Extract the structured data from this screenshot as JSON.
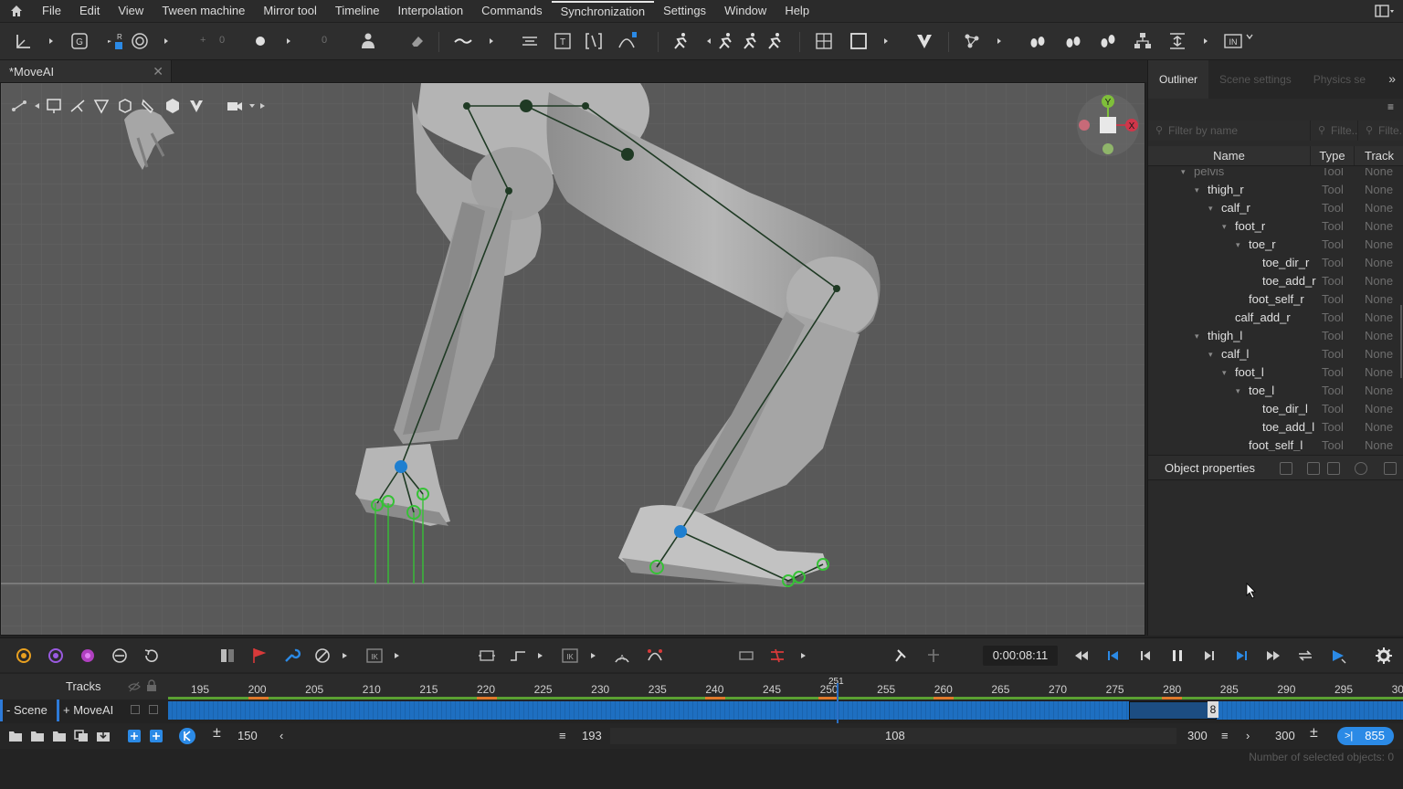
{
  "menu": {
    "items": [
      "File",
      "Edit",
      "View",
      "Tween machine",
      "Mirror tool",
      "Timeline",
      "Interpolation",
      "Commands",
      "Synchronization",
      "Settings",
      "Window",
      "Help"
    ]
  },
  "toolbar": {
    "num1": "0",
    "num2": "0",
    "in_label": "IN"
  },
  "document_tab": {
    "title": "*MoveAI"
  },
  "right_panel": {
    "tabs": [
      "Outliner",
      "Scene settings",
      "Physics se"
    ],
    "filters": [
      "Filter by name",
      "Filte...",
      "Filte..."
    ],
    "columns": {
      "name": "Name",
      "type": "Type",
      "track": "Track"
    },
    "tree": [
      {
        "name": "pelvis",
        "type": "Tool",
        "track": "None",
        "depth": 0,
        "dim": true,
        "toggle": "▾"
      },
      {
        "name": "thigh_r",
        "type": "Tool",
        "track": "None",
        "depth": 1,
        "toggle": "▾"
      },
      {
        "name": "calf_r",
        "type": "Tool",
        "track": "None",
        "depth": 2,
        "toggle": "▾"
      },
      {
        "name": "foot_r",
        "type": "Tool",
        "track": "None",
        "depth": 3,
        "toggle": "▾"
      },
      {
        "name": "toe_r",
        "type": "Tool",
        "track": "None",
        "depth": 4,
        "toggle": "▾"
      },
      {
        "name": "toe_dir_r",
        "type": "Tool",
        "track": "None",
        "depth": 5,
        "toggle": ""
      },
      {
        "name": "toe_add_r",
        "type": "Tool",
        "track": "None",
        "depth": 5,
        "toggle": ""
      },
      {
        "name": "foot_self_r",
        "type": "Tool",
        "track": "None",
        "depth": 4,
        "toggle": ""
      },
      {
        "name": "calf_add_r",
        "type": "Tool",
        "track": "None",
        "depth": 3,
        "toggle": ""
      },
      {
        "name": "thigh_l",
        "type": "Tool",
        "track": "None",
        "depth": 1,
        "toggle": "▾"
      },
      {
        "name": "calf_l",
        "type": "Tool",
        "track": "None",
        "depth": 2,
        "toggle": "▾"
      },
      {
        "name": "foot_l",
        "type": "Tool",
        "track": "None",
        "depth": 3,
        "toggle": "▾"
      },
      {
        "name": "toe_l",
        "type": "Tool",
        "track": "None",
        "depth": 4,
        "toggle": "▾"
      },
      {
        "name": "toe_dir_l",
        "type": "Tool",
        "track": "None",
        "depth": 5,
        "toggle": ""
      },
      {
        "name": "toe_add_l",
        "type": "Tool",
        "track": "None",
        "depth": 5,
        "toggle": ""
      },
      {
        "name": "foot_self_l",
        "type": "Tool",
        "track": "None",
        "depth": 4,
        "toggle": ""
      }
    ],
    "object_properties": "Object properties"
  },
  "gizmo": {
    "y": "Y",
    "x": "X"
  },
  "timeline": {
    "time": "0:00:08:11",
    "tracks_label": "Tracks",
    "ruler": [
      "195",
      "200",
      "205",
      "210",
      "215",
      "220",
      "225",
      "230",
      "235",
      "240",
      "245",
      "250",
      "255",
      "260",
      "265",
      "270",
      "275",
      "280",
      "285",
      "290",
      "295",
      "300"
    ],
    "playhead_frame": "251",
    "scene_label": "- Scene",
    "movea_label": "+ MoveAI",
    "key_label": "8"
  },
  "bottom": {
    "fps": "150",
    "start": "193",
    "middle": "108",
    "end1": "300",
    "end2": "300",
    "total": "855",
    "status": "Number of selected objects: 0"
  },
  "colors": {
    "accent": "#2b8ae6",
    "bone_green": "#36c136",
    "joint_blue": "#1f7fd0"
  }
}
